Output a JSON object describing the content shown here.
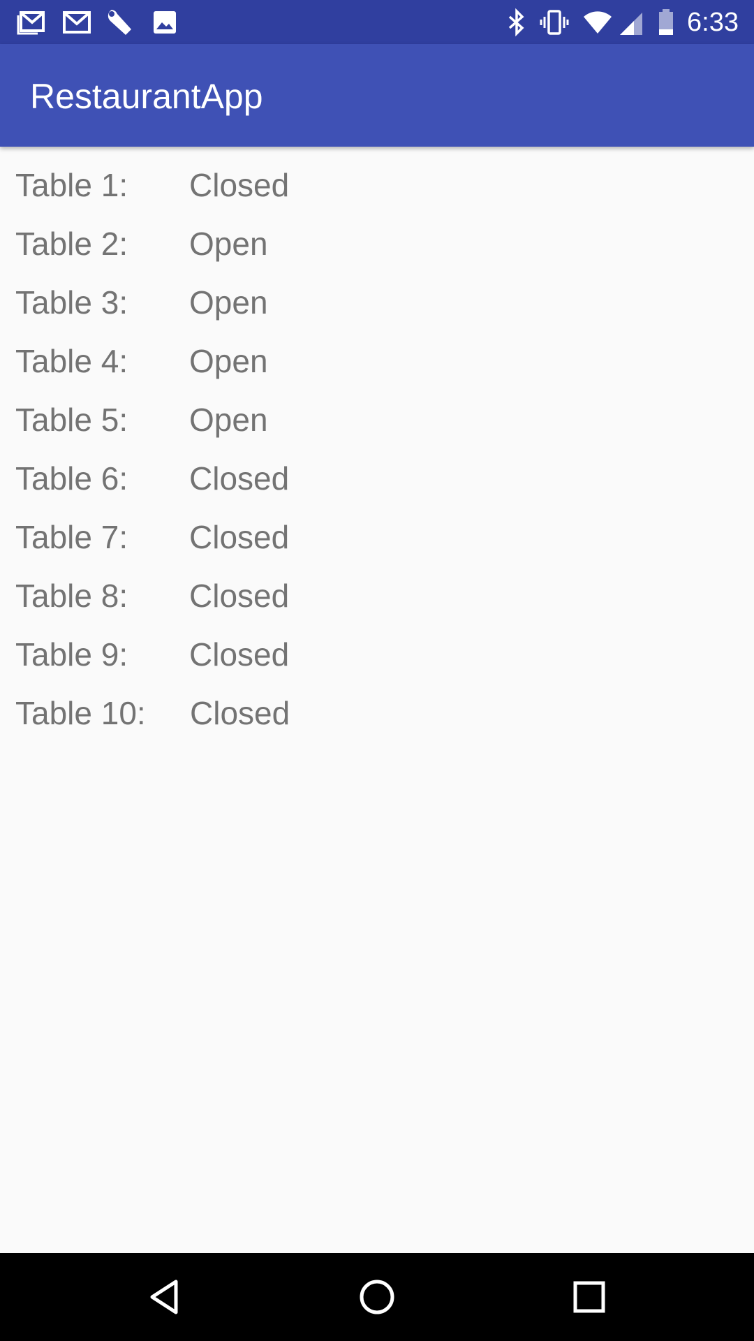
{
  "status_bar": {
    "time": "6:33",
    "left_icons": [
      "gmail-icon",
      "mail-icon",
      "wrench-icon",
      "image-icon"
    ],
    "right_icons": [
      "bluetooth-icon",
      "vibrate-icon",
      "wifi-icon",
      "cell-signal-icon",
      "battery-icon"
    ]
  },
  "app_bar": {
    "title": "RestaurantApp",
    "color": "#3f51b5",
    "status_color": "#303f9f"
  },
  "tables": [
    {
      "label": "Table 1:",
      "status": "Closed"
    },
    {
      "label": "Table 2:",
      "status": "Open"
    },
    {
      "label": "Table 3:",
      "status": "Open"
    },
    {
      "label": "Table 4:",
      "status": "Open"
    },
    {
      "label": "Table 5:",
      "status": "Open"
    },
    {
      "label": "Table 6:",
      "status": "Closed"
    },
    {
      "label": "Table 7:",
      "status": "Closed"
    },
    {
      "label": "Table 8:",
      "status": "Closed"
    },
    {
      "label": "Table 9:",
      "status": "Closed"
    },
    {
      "label": "Table 10:",
      "status": "Closed"
    }
  ],
  "nav_bar": {
    "buttons": [
      "back-icon",
      "home-icon",
      "recents-icon"
    ]
  }
}
